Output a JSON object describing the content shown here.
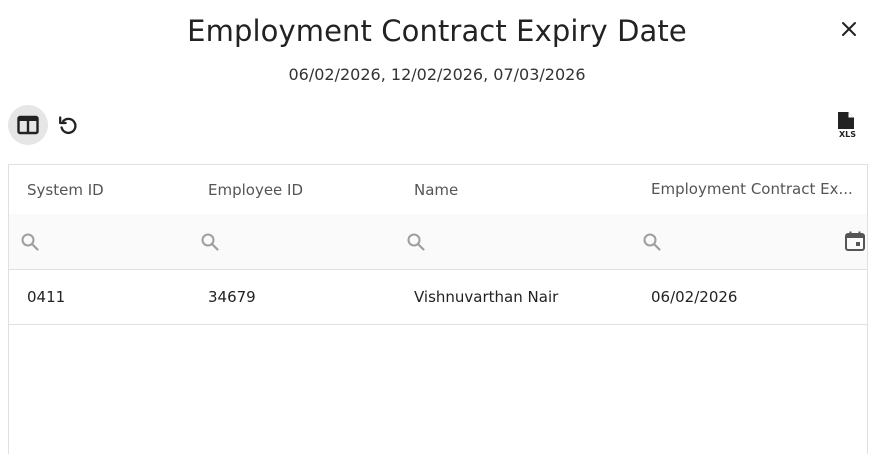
{
  "dialog": {
    "title": "Employment Contract Expiry Date",
    "subtitle": "06/02/2026, 12/02/2026, 07/03/2026"
  },
  "toolbar": {
    "icons": [
      "view-columns-icon",
      "reset-icon",
      "xls-export-icon"
    ],
    "export_badge": "XLS"
  },
  "table": {
    "columns": [
      "System ID",
      "Employee ID",
      "Name",
      "Employment Contract Ex..."
    ],
    "rows": [
      [
        "0411",
        "34679",
        "Vishnuvarthan Nair",
        "06/02/2026"
      ]
    ]
  },
  "colors": {
    "header_text": "#555555",
    "border": "#e0e0e0",
    "icon": "#222222"
  }
}
